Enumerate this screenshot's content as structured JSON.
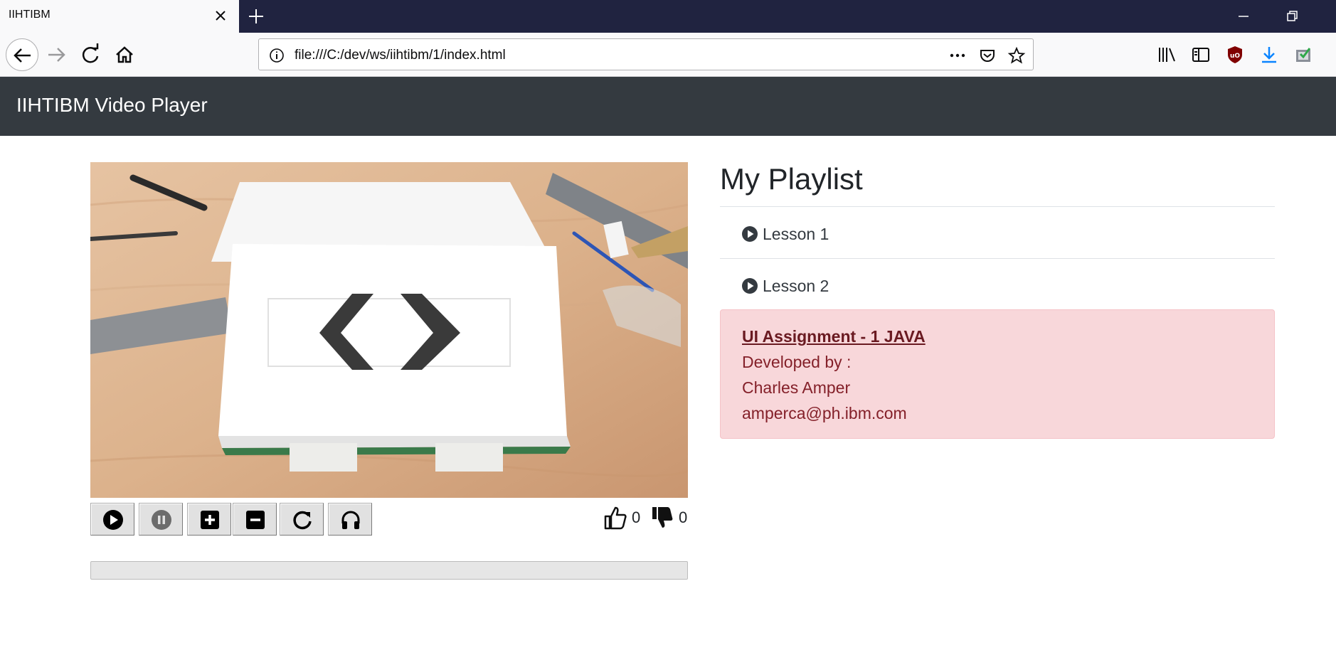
{
  "browser": {
    "tab_title": "IIHTIBM",
    "url": "file:///C:/dev/ws/iihtibm/1/index.html"
  },
  "app": {
    "title": "IIHTIBM Video Player"
  },
  "player": {
    "controls": [
      "play",
      "pause",
      "volume-up",
      "volume-down",
      "reload",
      "mute"
    ],
    "likes": "0",
    "dislikes": "0",
    "progress": 0
  },
  "playlist": {
    "title": "My Playlist",
    "items": [
      {
        "label": "Lesson 1"
      },
      {
        "label": "Lesson 2"
      }
    ]
  },
  "info": {
    "title": "UI Assignment - 1 JAVA",
    "developed_by": "Developed by :",
    "name": "Charles Amper",
    "email": "amperca@ph.ibm.com"
  },
  "colors": {
    "header_bg": "#343a40",
    "alert_bg": "#f8d7da",
    "alert_text": "#842029",
    "tabbar_bg": "#202340"
  }
}
